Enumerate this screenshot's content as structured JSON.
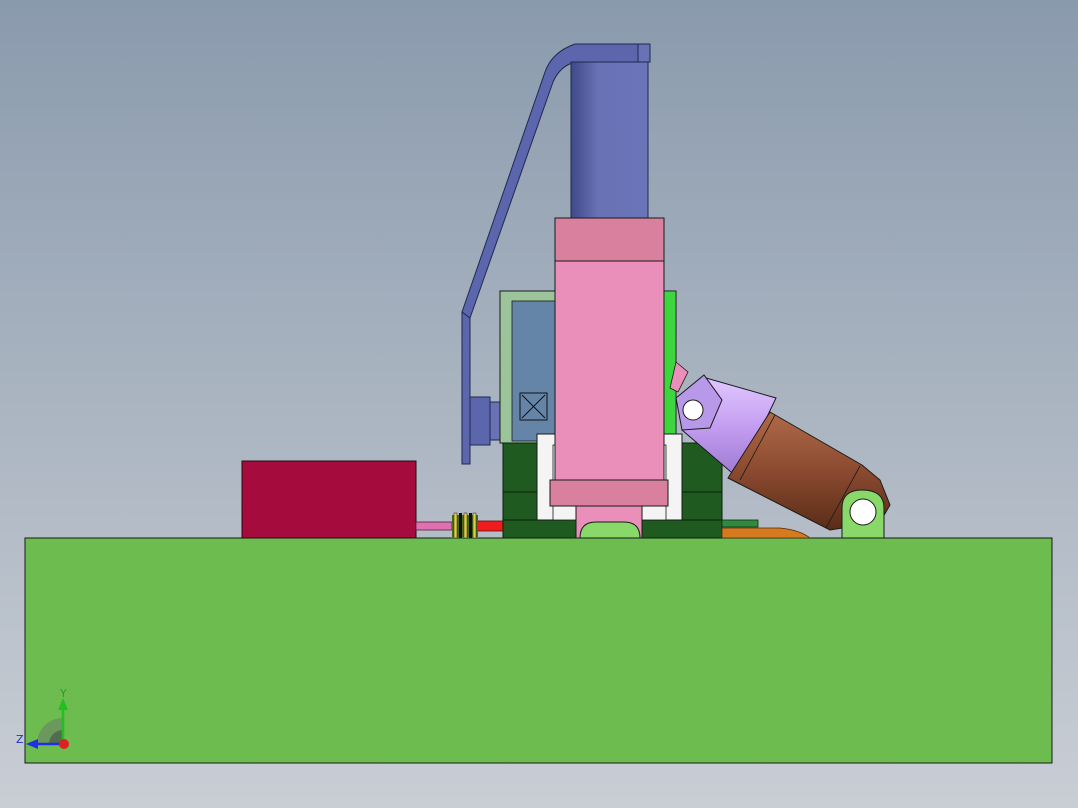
{
  "viewport": {
    "background_top": "#8a9aad",
    "background_bottom": "#c9ced5"
  },
  "model": {
    "base_color": "#6cbc4f",
    "block_color": "#a50b3c",
    "cylinder_color": "#6872b5",
    "bracket_color": "#5c66ad",
    "slide_color": "#e98fb9",
    "clamp_color": "#1f5a20",
    "arm_color": "#c8a3f0",
    "arm_end_color": "#8b4a30",
    "pin_color": "#88d86a"
  },
  "triad": {
    "y_label": "Y",
    "z_label": "Z",
    "x_color": "#e02020",
    "y_color": "#20c020",
    "z_color": "#2030e0"
  }
}
